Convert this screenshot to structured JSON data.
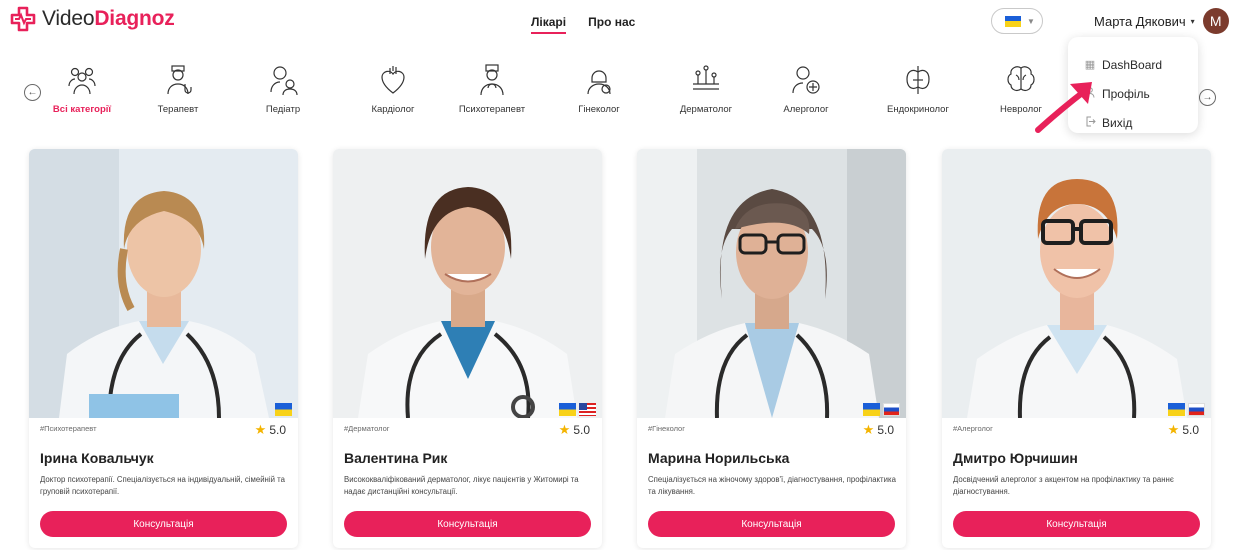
{
  "header": {
    "logo_video": "Video",
    "logo_diagnoz": "Diagnoz",
    "nav": [
      {
        "label": "Лікарі",
        "active": true
      },
      {
        "label": "Про нас",
        "active": false
      }
    ],
    "user_name": "Марта Дякович",
    "avatar_letter": "M",
    "accent_color": "#e8215a"
  },
  "dropdown": {
    "items": [
      {
        "label": "DashBoard",
        "icon": "grid-icon"
      },
      {
        "label": "Профіль",
        "icon": "user-icon"
      },
      {
        "label": "Вихід",
        "icon": "logout-icon"
      }
    ]
  },
  "categories": [
    {
      "label": "Всі категорії",
      "active": true,
      "icon": "group-icon"
    },
    {
      "label": "Терапевт",
      "active": false,
      "icon": "therapist-icon"
    },
    {
      "label": "Педіатр",
      "active": false,
      "icon": "pediatrician-icon"
    },
    {
      "label": "Кардіолог",
      "active": false,
      "icon": "heart-icon"
    },
    {
      "label": "Психотерапевт",
      "active": false,
      "icon": "psychotherapist-icon"
    },
    {
      "label": "Гінеколог",
      "active": false,
      "icon": "gynecologist-icon"
    },
    {
      "label": "Дерматолог",
      "active": false,
      "icon": "dermatologist-icon"
    },
    {
      "label": "Алерголог",
      "active": false,
      "icon": "allergist-icon"
    },
    {
      "label": "Ендокринолог",
      "active": false,
      "icon": "thyroid-icon"
    },
    {
      "label": "Невролог",
      "active": false,
      "icon": "brain-icon"
    }
  ],
  "doctors": [
    {
      "tag": "#Психотерапевт",
      "rating": "5.0",
      "name": "Ірина Ковальчук",
      "description": "Доктор психотерапії. Спеціалізується на індивідуальній, сімейній та груповій психотерапії.",
      "button": "Консультація",
      "flags": [
        "ua"
      ]
    },
    {
      "tag": "#Дерматолог",
      "rating": "5.0",
      "name": "Валентина Рик",
      "description": "Висококваліфікований дерматолог, лікує пацієнтів у Житомирі та надає дистанційні консультації.",
      "button": "Консультація",
      "flags": [
        "ua",
        "us"
      ]
    },
    {
      "tag": "#Гінеколог",
      "rating": "5.0",
      "name": "Марина Норильська",
      "description": "Спеціалізується на жіночому здоров'ї, діагностування, профілактика та лікування.",
      "button": "Консультація",
      "flags": [
        "ua",
        "ru"
      ]
    },
    {
      "tag": "#Алерголог",
      "rating": "5.0",
      "name": "Дмитро Юрчишин",
      "description": "Досвідчений алерголог з акцентом на профілактику та раннє діагностування.",
      "button": "Консультація",
      "flags": [
        "ua",
        "ru"
      ]
    }
  ]
}
